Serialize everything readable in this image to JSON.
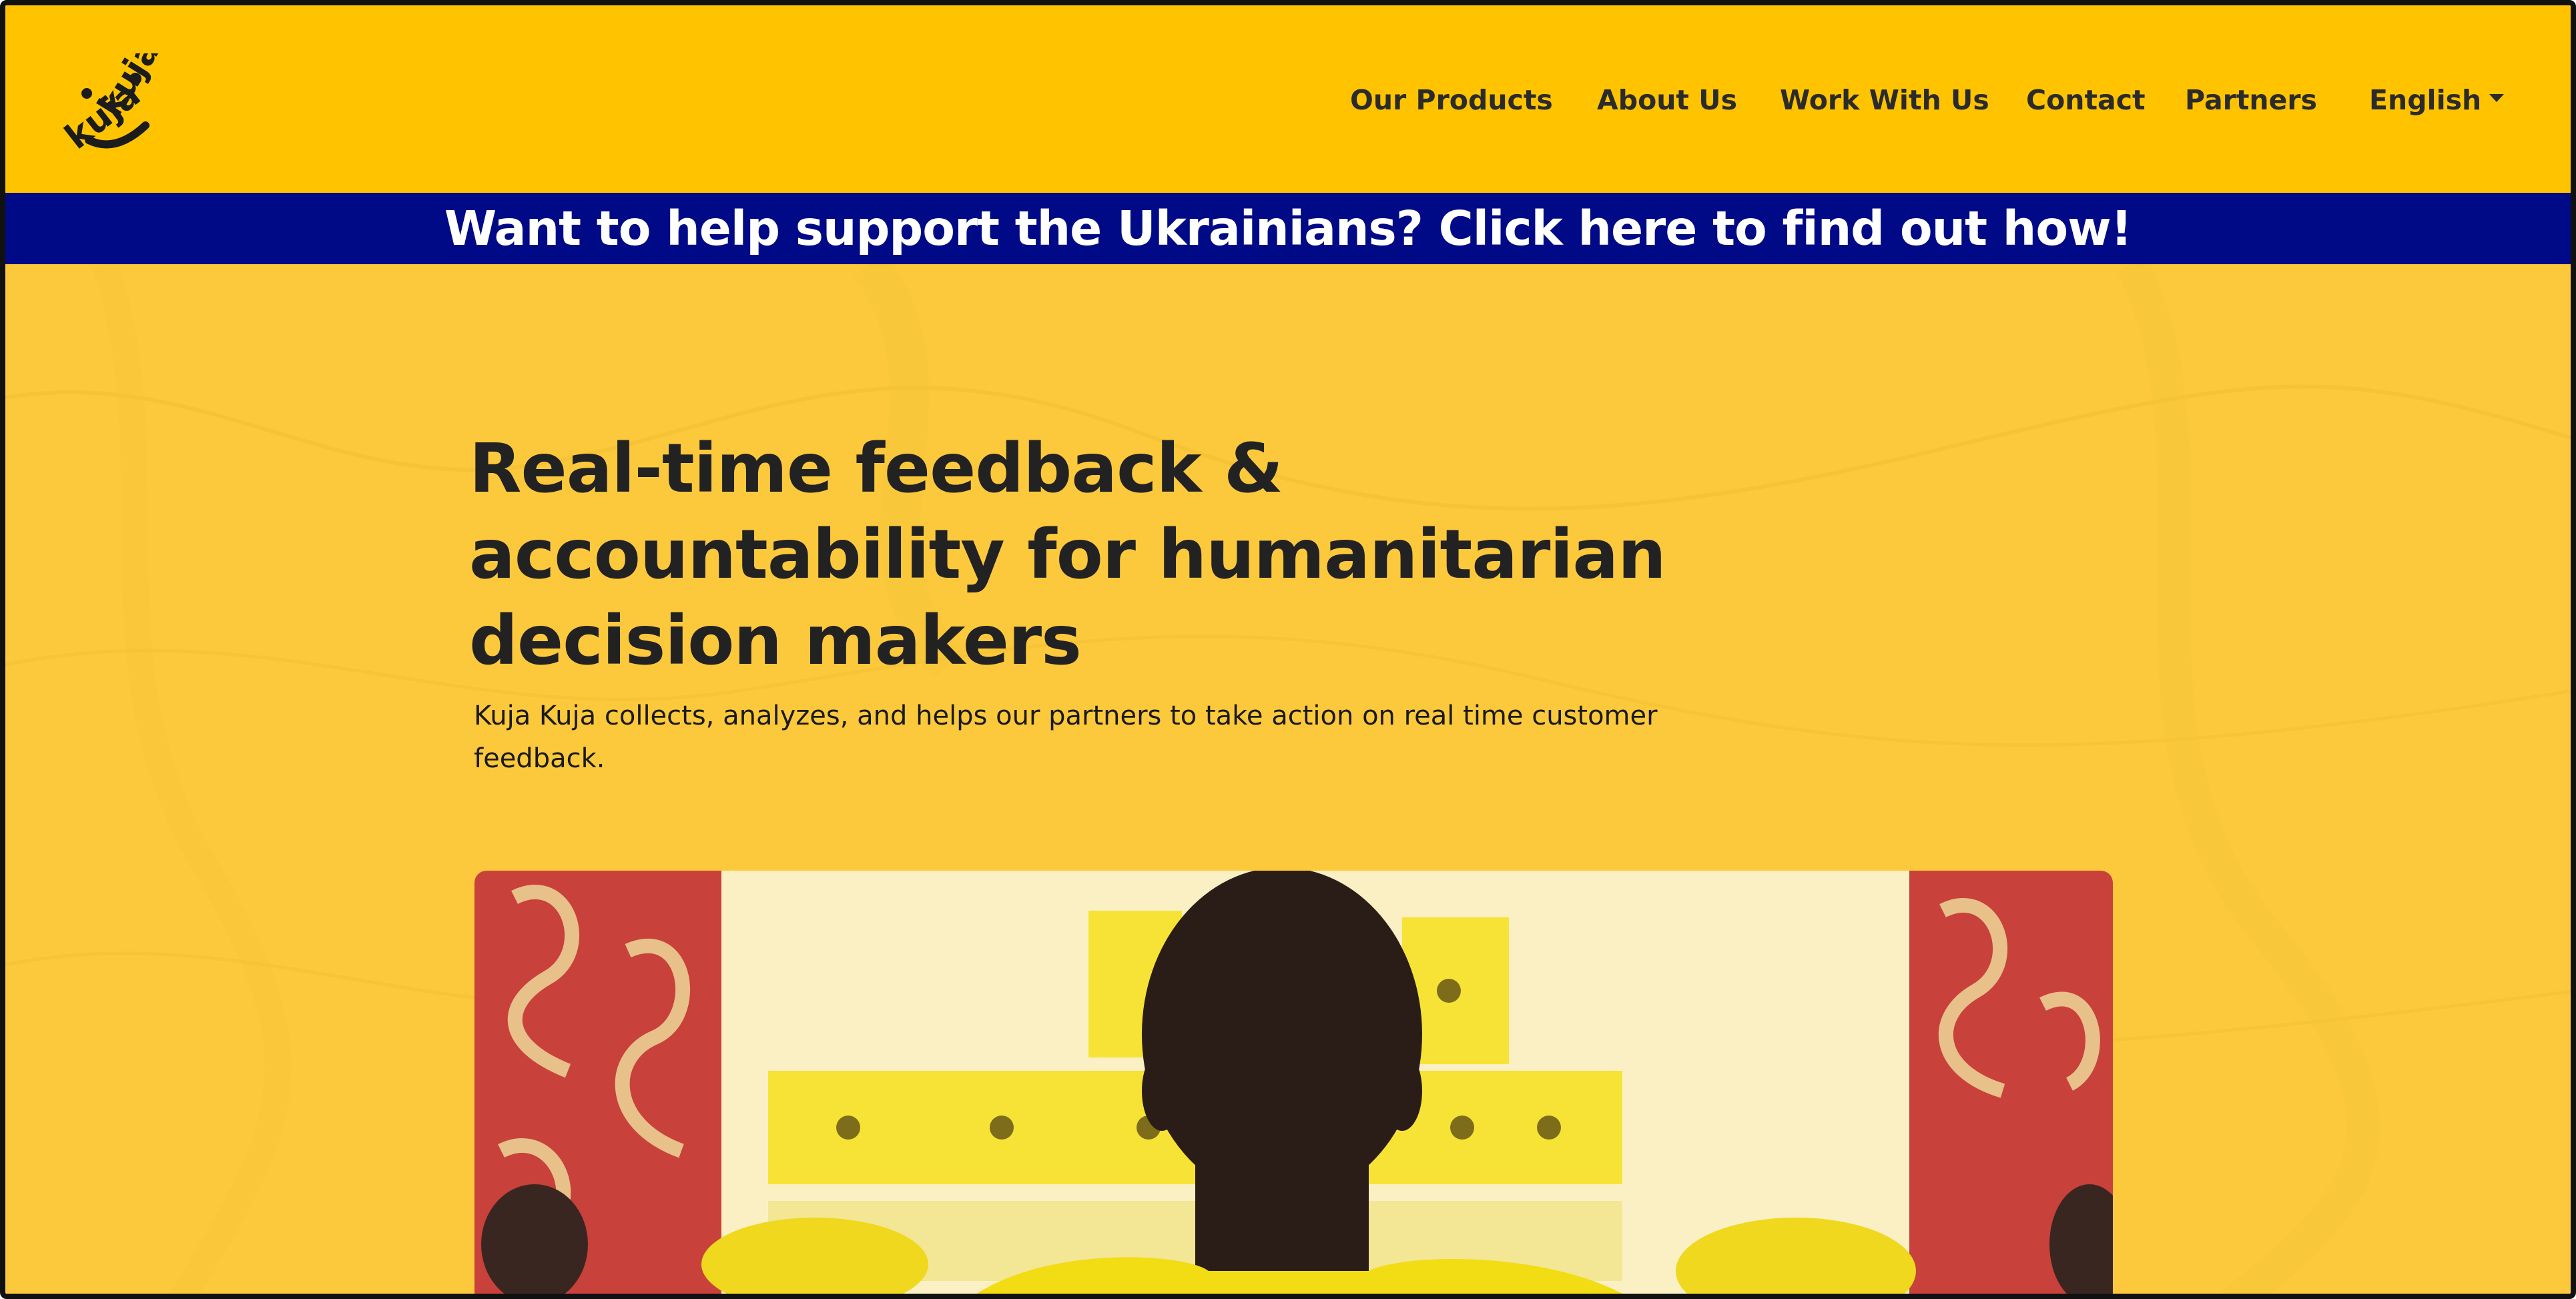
{
  "header": {
    "logo_alt": "kuja kuja",
    "nav": {
      "products": "Our Products",
      "about": "About Us",
      "work": "Work With Us",
      "contact": "Contact",
      "partners": "Partners",
      "language": "English"
    }
  },
  "banner": {
    "text": "Want to help support the Ukrainians? Click here to find out how!"
  },
  "hero": {
    "title_lines": [
      "Real-time feedback &",
      "accountability for humanitarian",
      "decision makers"
    ],
    "subtitle_lines": [
      "Kuja Kuja collects, analyzes, and helps our partners to take action on real time customer",
      "feedback."
    ]
  },
  "colors": {
    "header_bg": "#ffc300",
    "banner_bg": "#000a87",
    "hero_bg": "#fdc93c",
    "text_dark": "#222222"
  },
  "icons": {
    "logo": "kuja-kuja-smile-logo",
    "language_dropdown": "caret-down-icon"
  }
}
